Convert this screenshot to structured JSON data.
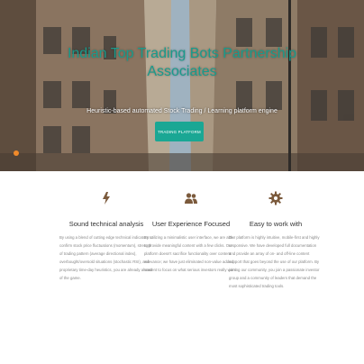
{
  "hero": {
    "title": "Indian Top Trading Bots Partnership Associates",
    "subtitle": "Heuristic-based automated Stock Trading / Learning platform engine",
    "button_label": "TRADING PLATFORM"
  },
  "features": [
    {
      "icon": "bolt-icon",
      "title": "Sound technical analysis",
      "text": "By using a blend of cutting edge technical indicators to confirm stock price fluctuations (momentum), strength of trading pattern (average directional index), overbought/oversold situations (stochastic RSI), and proprietary time-day heuristics, you are already ahead of the game."
    },
    {
      "icon": "users-icon",
      "title": "User Experience Focused",
      "text": "By utilizing a minimalistic user interface, we are able to provide meaningful content with a few clicks. Our platform doesn't sacrifice functionality over content relevance; we have just eliminated non-value added content to focus on what serious investors really want."
    },
    {
      "icon": "gear-icon",
      "title": "Easy to work with",
      "text": "Our platform is highly intuitive, mobile-first and highly responsive. We have developed full documentation and provide an array of on- and off-line content support that goes beyond the use of our platform. By joining our community, you join a passionate investor group and a community of leaders that demand the most sophisticated trading tools."
    }
  ],
  "colors": {
    "accent": "#1aa794",
    "title": "#1a9b8c",
    "icon": "#7b5a3c"
  }
}
